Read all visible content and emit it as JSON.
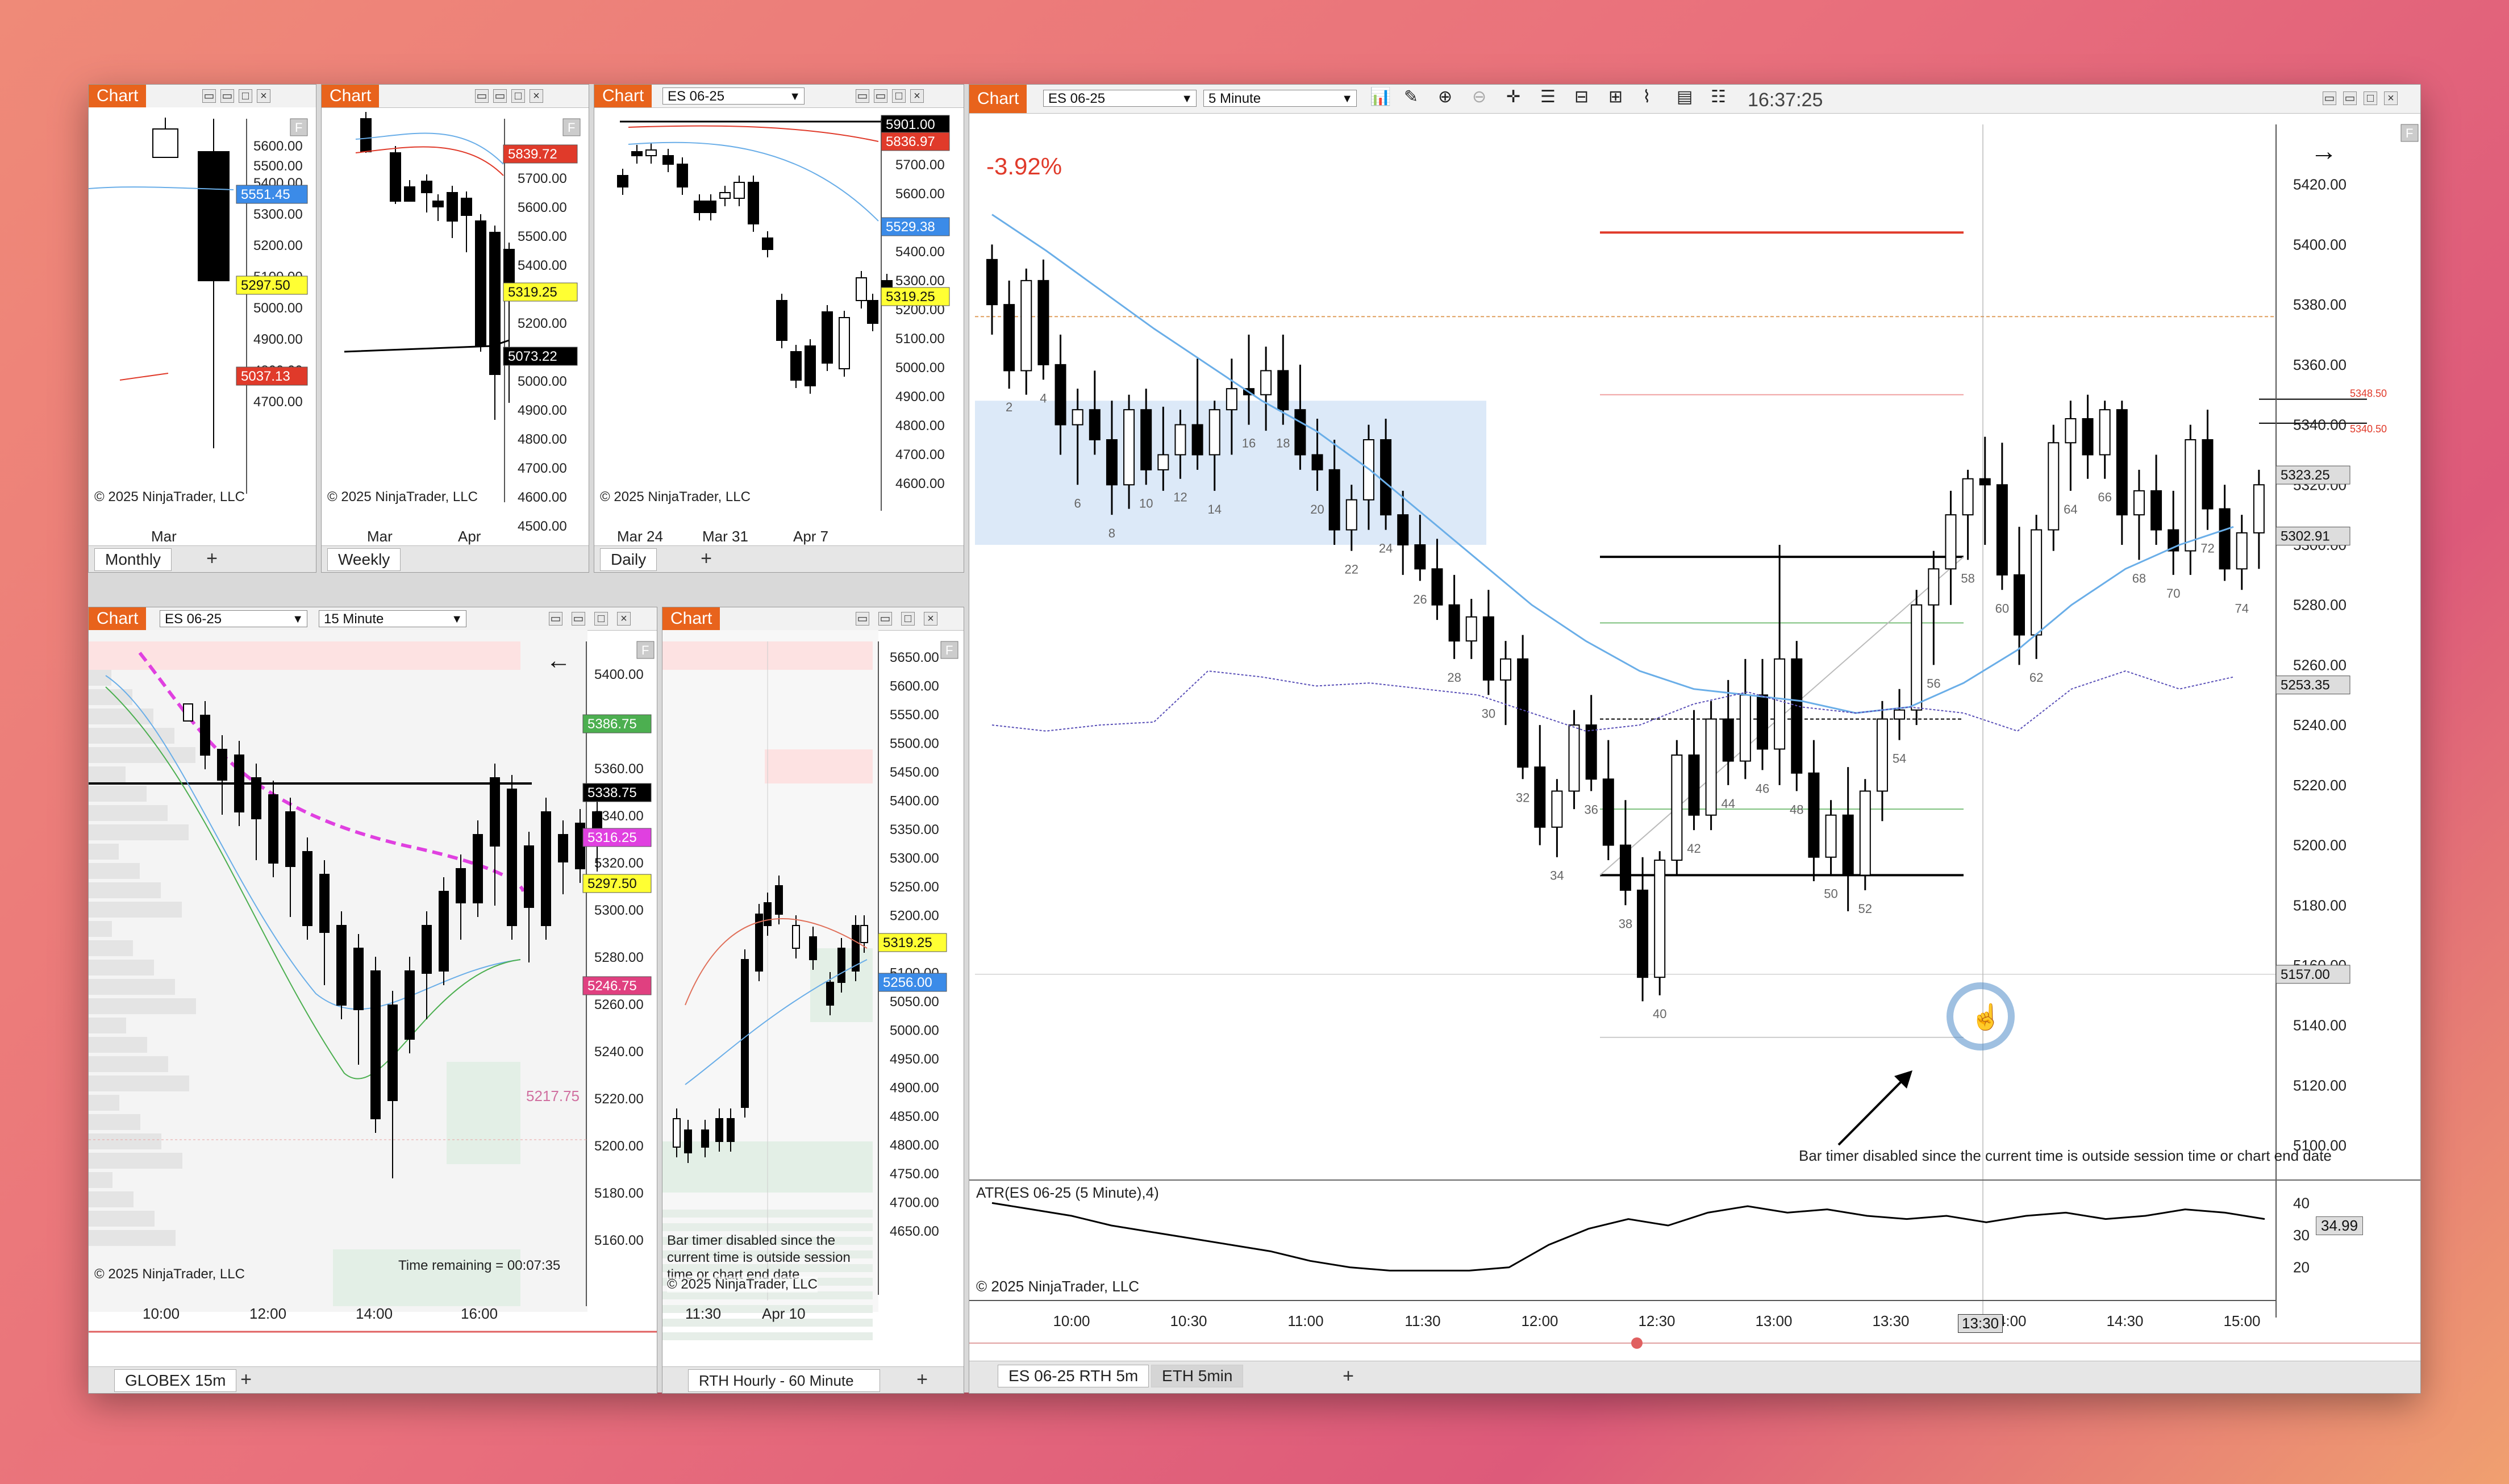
{
  "colors": {
    "accent": "#e8631c",
    "up": "#ffffff",
    "down": "#000000",
    "ema": "#6aaee8",
    "red": "#e03a2a",
    "green": "#4caf50",
    "magenta": "#e040e0",
    "yellow": "#ffff33",
    "blue_tag": "#3b8be8",
    "zone": "#cfe2f7"
  },
  "windows": {
    "monthly": {
      "title": "Chart",
      "tab": "Monthly",
      "copyright": "© 2025 NinjaTrader, LLC",
      "xlabel": "Mar"
    },
    "weekly": {
      "title": "Chart",
      "tab": "Weekly",
      "copyright": "© 2025 NinjaTrader, LLC",
      "xlabels": [
        "Mar",
        "Apr"
      ]
    },
    "daily": {
      "title": "Chart",
      "instrument": "ES 06-25",
      "tab": "Daily",
      "copyright": "© 2025 NinjaTrader, LLC",
      "xlabels": [
        "Mar 24",
        "Mar 31",
        "Apr 7"
      ]
    },
    "globex": {
      "title": "Chart",
      "instrument": "ES 06-25",
      "interval": "15 Minute",
      "tab": "GLOBEX 15m",
      "copyright": "© 2025 NinjaTrader, LLC",
      "timer": "Time remaining = 00:07:35",
      "level_label": "5217.75",
      "xlabels": [
        "10:00",
        "12:00",
        "14:00",
        "16:00"
      ]
    },
    "hourly": {
      "title": "Chart",
      "tab": "RTH Hourly -  60 Minute",
      "copyright": "© 2025 NinjaTrader, LLC",
      "timer_note": "Bar timer disabled since the current time is outside session time or chart end date",
      "xlabels": [
        "11:30",
        "Apr 10"
      ]
    },
    "main": {
      "title": "Chart",
      "instrument": "ES 06-25",
      "interval": "5 Minute",
      "clock": "16:37:25",
      "pct": "-3.92%",
      "tabs": [
        "ES 06-25 RTH 5m",
        "ETH 5min"
      ],
      "copyright": "© 2025 NinjaTrader, LLC",
      "timer_note": "Bar timer disabled since the current time is outside session time or chart end date",
      "atr_label": "ATR(ES 06-25 (5 Minute),4)",
      "atr_value": "34.99",
      "cursor_time": "13:30"
    }
  },
  "chart_data": [
    {
      "type": "candlestick",
      "name": "Monthly",
      "yticks": [
        5600,
        5500,
        5400,
        5300,
        5200,
        5100,
        5000,
        4900,
        4800,
        4700
      ],
      "tags": [
        {
          "text": "5551.45",
          "color": "#3b8be8"
        },
        {
          "text": "5297.50",
          "color": "#ffff33"
        },
        {
          "text": "5037.13",
          "color": "#e03a2a"
        }
      ]
    },
    {
      "type": "candlestick",
      "name": "Weekly",
      "yticks": [
        5700,
        5600,
        5500,
        5400,
        5300,
        5200,
        5100,
        5000,
        4900,
        4800,
        4700,
        4600,
        4500
      ],
      "tags": [
        {
          "text": "5839.72",
          "color": "#e03a2a"
        },
        {
          "text": "5319.25",
          "color": "#ffff33"
        },
        {
          "text": "5073.22",
          "color": "#000000"
        }
      ]
    },
    {
      "type": "candlestick",
      "name": "Daily",
      "yticks": [
        5800,
        5700,
        5600,
        5500,
        5400,
        5300,
        5200,
        5100,
        5000,
        4900,
        4800,
        4700,
        4600
      ],
      "tags": [
        {
          "text": "5901.00",
          "color": "#000000"
        },
        {
          "text": "5836.97",
          "color": "#e03a2a"
        },
        {
          "text": "5529.38",
          "color": "#3b8be8"
        },
        {
          "text": "5319.25",
          "color": "#ffff33"
        }
      ]
    },
    {
      "type": "candlestick",
      "name": "GLOBEX 15m",
      "yticks": [
        5400,
        5380,
        5360,
        5340,
        5320,
        5300,
        5280,
        5260,
        5240,
        5220,
        5200,
        5180,
        5160
      ],
      "tags": [
        {
          "text": "5386.75",
          "color": "#4caf50"
        },
        {
          "text": "5338.75",
          "color": "#000000"
        },
        {
          "text": "5316.25",
          "color": "#e040e0"
        },
        {
          "text": "5297.50",
          "color": "#ffff33"
        },
        {
          "text": "5246.75",
          "color": "#e04080"
        }
      ]
    },
    {
      "type": "candlestick",
      "name": "RTH Hourly",
      "yticks": [
        5650,
        5600,
        5550,
        5500,
        5450,
        5400,
        5350,
        5300,
        5250,
        5200,
        5150,
        5100,
        5050,
        5000,
        4950,
        4900,
        4850,
        4800,
        4750,
        4700,
        4650
      ],
      "tags": [
        {
          "text": "5319.25",
          "color": "#ffff33"
        },
        {
          "text": "5256.00",
          "color": "#3b8be8"
        }
      ]
    },
    {
      "type": "candlestick",
      "name": "ES 06-25 RTH 5m",
      "ylim": [
        5090,
        5440
      ],
      "yticks": [
        5420,
        5400,
        5380,
        5360,
        5340,
        5320,
        5300,
        5280,
        5260,
        5240,
        5220,
        5200,
        5180,
        5160,
        5140,
        5120,
        5100
      ],
      "xticks": [
        "10:00",
        "10:30",
        "11:00",
        "11:30",
        "12:00",
        "12:30",
        "13:00",
        "13:30",
        "14:00",
        "14:30",
        "15:00"
      ],
      "tags": [
        {
          "text": "5323.25",
          "color": "#dddddd"
        },
        {
          "text": "5302.91",
          "color": "#dddddd"
        },
        {
          "text": "5253.35",
          "color": "#dddddd"
        },
        {
          "text": "5157.00",
          "color": "#dddddd"
        }
      ],
      "levels": [
        {
          "text": "5348.50"
        },
        {
          "text": "5340.50"
        }
      ],
      "ohlc": [
        [
          5395,
          5400,
          5370,
          5380
        ],
        [
          5380,
          5388,
          5352,
          5358
        ],
        [
          5358,
          5392,
          5350,
          5388
        ],
        [
          5388,
          5395,
          5355,
          5360
        ],
        [
          5360,
          5370,
          5330,
          5340
        ],
        [
          5340,
          5352,
          5320,
          5345
        ],
        [
          5345,
          5358,
          5330,
          5335
        ],
        [
          5335,
          5348,
          5310,
          5320
        ],
        [
          5320,
          5350,
          5312,
          5345
        ],
        [
          5345,
          5352,
          5320,
          5325
        ],
        [
          5325,
          5346,
          5318,
          5330
        ],
        [
          5330,
          5345,
          5322,
          5340
        ],
        [
          5340,
          5362,
          5325,
          5330
        ],
        [
          5330,
          5348,
          5318,
          5345
        ],
        [
          5345,
          5362,
          5330,
          5352
        ],
        [
          5352,
          5370,
          5340,
          5350
        ],
        [
          5350,
          5366,
          5338,
          5358
        ],
        [
          5358,
          5370,
          5340,
          5345
        ],
        [
          5345,
          5360,
          5325,
          5330
        ],
        [
          5330,
          5342,
          5318,
          5325
        ],
        [
          5325,
          5335,
          5300,
          5305
        ],
        [
          5305,
          5320,
          5298,
          5315
        ],
        [
          5315,
          5340,
          5305,
          5335
        ],
        [
          5335,
          5342,
          5305,
          5310
        ],
        [
          5310,
          5318,
          5290,
          5300
        ],
        [
          5300,
          5310,
          5288,
          5292
        ],
        [
          5292,
          5302,
          5275,
          5280
        ],
        [
          5280,
          5290,
          5262,
          5268
        ],
        [
          5268,
          5282,
          5262,
          5276
        ],
        [
          5276,
          5285,
          5250,
          5255
        ],
        [
          5255,
          5268,
          5240,
          5262
        ],
        [
          5262,
          5270,
          5222,
          5226
        ],
        [
          5226,
          5240,
          5200,
          5206
        ],
        [
          5206,
          5222,
          5196,
          5218
        ],
        [
          5218,
          5245,
          5212,
          5240
        ],
        [
          5240,
          5250,
          5218,
          5222
        ],
        [
          5222,
          5235,
          5195,
          5200
        ],
        [
          5200,
          5215,
          5180,
          5185
        ],
        [
          5185,
          5196,
          5148,
          5156
        ],
        [
          5156,
          5198,
          5150,
          5195
        ],
        [
          5195,
          5235,
          5190,
          5230
        ],
        [
          5230,
          5245,
          5205,
          5210
        ],
        [
          5210,
          5248,
          5205,
          5242
        ],
        [
          5242,
          5255,
          5220,
          5228
        ],
        [
          5228,
          5262,
          5222,
          5250
        ],
        [
          5250,
          5262,
          5225,
          5232
        ],
        [
          5232,
          5300,
          5220,
          5262
        ],
        [
          5262,
          5268,
          5218,
          5224
        ],
        [
          5224,
          5235,
          5188,
          5196
        ],
        [
          5196,
          5215,
          5190,
          5210
        ],
        [
          5210,
          5226,
          5178,
          5190
        ],
        [
          5190,
          5222,
          5185,
          5218
        ],
        [
          5218,
          5248,
          5208,
          5242
        ],
        [
          5242,
          5252,
          5235,
          5245
        ],
        [
          5245,
          5285,
          5240,
          5280
        ],
        [
          5280,
          5298,
          5260,
          5292
        ],
        [
          5292,
          5318,
          5280,
          5310
        ],
        [
          5310,
          5325,
          5295,
          5322
        ],
        [
          5322,
          5336,
          5300,
          5320
        ],
        [
          5320,
          5334,
          5285,
          5290
        ],
        [
          5290,
          5306,
          5260,
          5270
        ],
        [
          5270,
          5310,
          5262,
          5305
        ],
        [
          5305,
          5340,
          5298,
          5334
        ],
        [
          5334,
          5348,
          5318,
          5342
        ],
        [
          5342,
          5350,
          5322,
          5330
        ],
        [
          5330,
          5348,
          5322,
          5345
        ],
        [
          5345,
          5348,
          5300,
          5310
        ],
        [
          5310,
          5325,
          5295,
          5318
        ],
        [
          5318,
          5330,
          5300,
          5305
        ],
        [
          5305,
          5318,
          5290,
          5298
        ],
        [
          5298,
          5340,
          5290,
          5335
        ],
        [
          5335,
          5345,
          5305,
          5312
        ],
        [
          5312,
          5320,
          5288,
          5292
        ],
        [
          5292,
          5310,
          5285,
          5304
        ],
        [
          5304,
          5325,
          5292,
          5320
        ]
      ]
    }
  ]
}
